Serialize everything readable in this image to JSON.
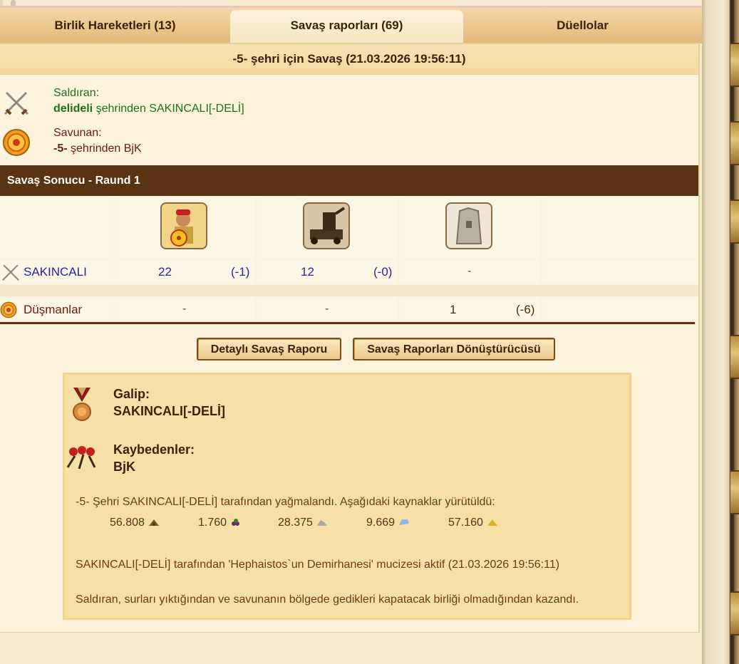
{
  "tabs": [
    {
      "label": "Birlik Hareketleri (13)",
      "active": false
    },
    {
      "label": "Savaş raporları (69)",
      "active": true
    },
    {
      "label": "Düellolar",
      "active": false
    }
  ],
  "battle": {
    "title": "-5- şehri için Savaş (21.03.2026 19:56:11)",
    "attacker": {
      "role": "Saldıran:",
      "city": "delideli",
      "suffix": "şehrinden SAKINCALI[-DELİ]"
    },
    "defender": {
      "role": "Savunan:",
      "city": "-5-",
      "suffix": "şehrinden BjK"
    }
  },
  "result_band": "Savaş Sonucu - Raund 1",
  "units_table": {
    "units": [
      "hoplite-unit",
      "catapult-unit",
      "wall-unit"
    ],
    "rows": [
      {
        "label": "SAKINCALI",
        "cells": [
          {
            "count": "22",
            "loss": "(-1)"
          },
          {
            "count": "12",
            "loss": "(-0)"
          },
          {
            "count": "-",
            "loss": ""
          }
        ]
      },
      {
        "label": "Düşmanlar",
        "cells": [
          {
            "count": "-",
            "loss": ""
          },
          {
            "count": "-",
            "loss": ""
          },
          {
            "count": "1",
            "loss": "(-6)"
          }
        ]
      }
    ]
  },
  "buttons": {
    "detail": "Detaylı Savaş Raporu",
    "converter": "Savaş Raporları Dönüştürücüsü"
  },
  "outcome": {
    "winner_label": "Galip:",
    "winner": "SAKINCALI[-DELİ]",
    "loser_label": "Kaybedenler:",
    "loser": "BjK",
    "pillage_text": "-5- Şehri SAKINCALI[-DELİ] tarafından yağmalandı. Aşağıdaki kaynaklar yürütüldü:",
    "resources": [
      {
        "amount": "56.808",
        "icon": "wood-icon"
      },
      {
        "amount": "1.760",
        "icon": "wine-icon"
      },
      {
        "amount": "28.375",
        "icon": "marble-icon"
      },
      {
        "amount": "9.669",
        "icon": "crystal-icon"
      },
      {
        "amount": "57.160",
        "icon": "sulfur-icon"
      }
    ],
    "wonder_text": "SAKINCALI[-DELİ] tarafından 'Hephaistos`un Demirhanesi' mucizesi aktif (21.03.2026 19:56:11)",
    "reason_text": "Saldıran, surları yıktığından ve savunanın bölgede gedikleri kapatacak birliği olmadığından kazandı."
  },
  "colors": {
    "band": "#5a3312",
    "attacker_text": "#1f6f1f",
    "defender_text": "#6e1a12",
    "unit_count": "#2424a8"
  }
}
